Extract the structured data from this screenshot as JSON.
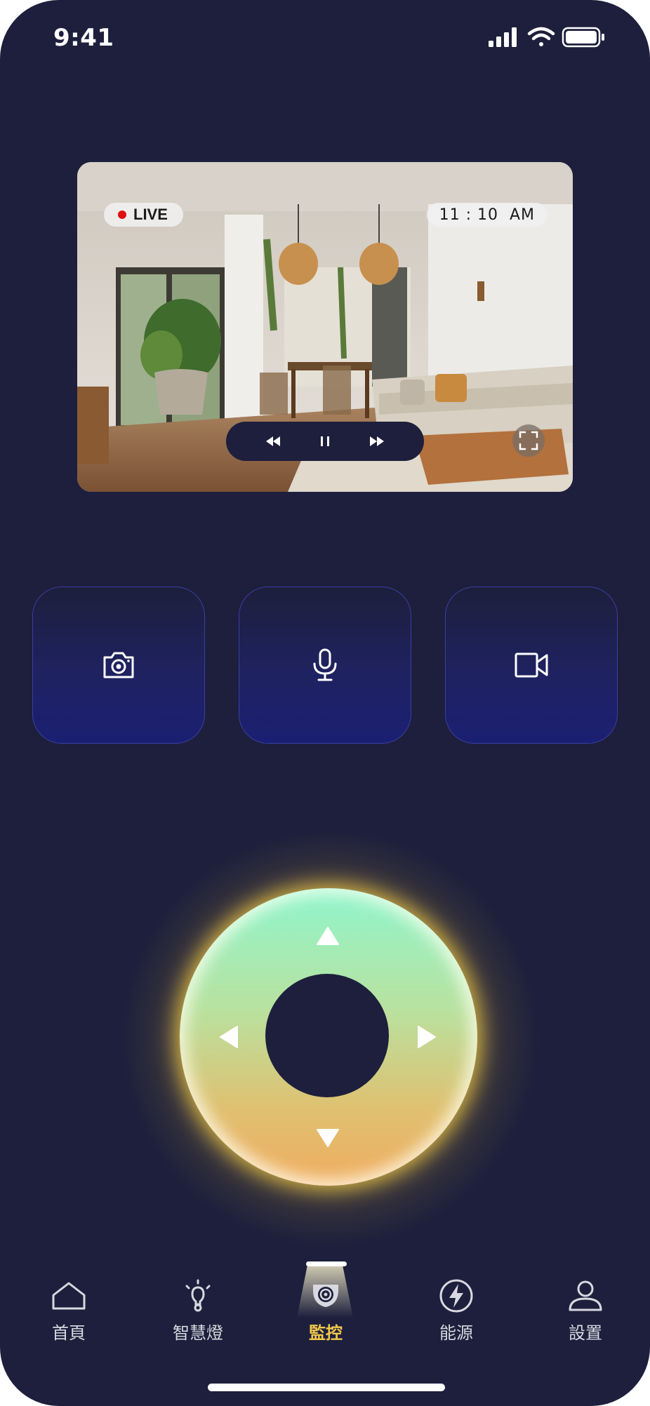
{
  "status_bar": {
    "time": "9:41"
  },
  "camera": {
    "live_label": "LIVE",
    "timestamp": "11 : 10  AM"
  },
  "tab_bar": {
    "items": [
      {
        "label": "首頁",
        "icon": "home-icon",
        "active": false
      },
      {
        "label": "智慧燈",
        "icon": "bulb-icon",
        "active": false
      },
      {
        "label": "監控",
        "icon": "security-camera-icon",
        "active": true
      },
      {
        "label": "能源",
        "icon": "energy-icon",
        "active": false
      },
      {
        "label": "設置",
        "icon": "user-icon",
        "active": false
      }
    ]
  },
  "colors": {
    "background": "#1d1f3c",
    "active_tab": "#f2c84a",
    "live_dot": "#e01010",
    "button_border": "#3a3fa4"
  }
}
